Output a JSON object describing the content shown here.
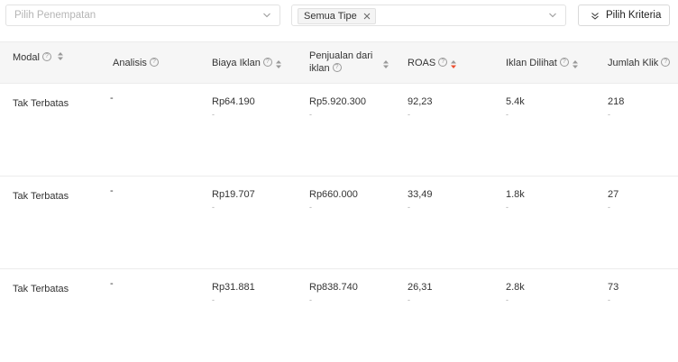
{
  "filters": {
    "placement_placeholder": "Pilih Penempatan",
    "type_tag": "Semua Tipe",
    "criteria_button": "Pilih Kriteria"
  },
  "columns": [
    {
      "label": "Modal",
      "help": "?"
    },
    {
      "label": "Analisis",
      "help": "?"
    },
    {
      "label": "Biaya Iklan",
      "help": "?"
    },
    {
      "label": "Penjualan dari",
      "label2": "iklan",
      "help": "?"
    },
    {
      "label": "ROAS",
      "help": "?"
    },
    {
      "label": "Iklan Dilihat",
      "help": "?"
    },
    {
      "label": "Jumlah Klik",
      "help": "?"
    }
  ],
  "rows": [
    {
      "modal": "Tak Terbatas",
      "analisis": "-",
      "biaya": "Rp64.190",
      "penjualan": "Rp5.920.300",
      "roas": "92,23",
      "dilihat": "5.4k",
      "klik": "218",
      "sub": "-"
    },
    {
      "modal": "Tak Terbatas",
      "analisis": "-",
      "biaya": "Rp19.707",
      "penjualan": "Rp660.000",
      "roas": "33,49",
      "dilihat": "1.8k",
      "klik": "27",
      "sub": "-"
    },
    {
      "modal": "Tak Terbatas",
      "analisis": "-",
      "biaya": "Rp31.881",
      "penjualan": "Rp838.740",
      "roas": "26,31",
      "dilihat": "2.8k",
      "klik": "73",
      "sub": "-"
    }
  ],
  "colors": {
    "accent_sort": "#ee4d2d",
    "border": "#e2e2e2",
    "header_bg": "#f6f6f6"
  }
}
